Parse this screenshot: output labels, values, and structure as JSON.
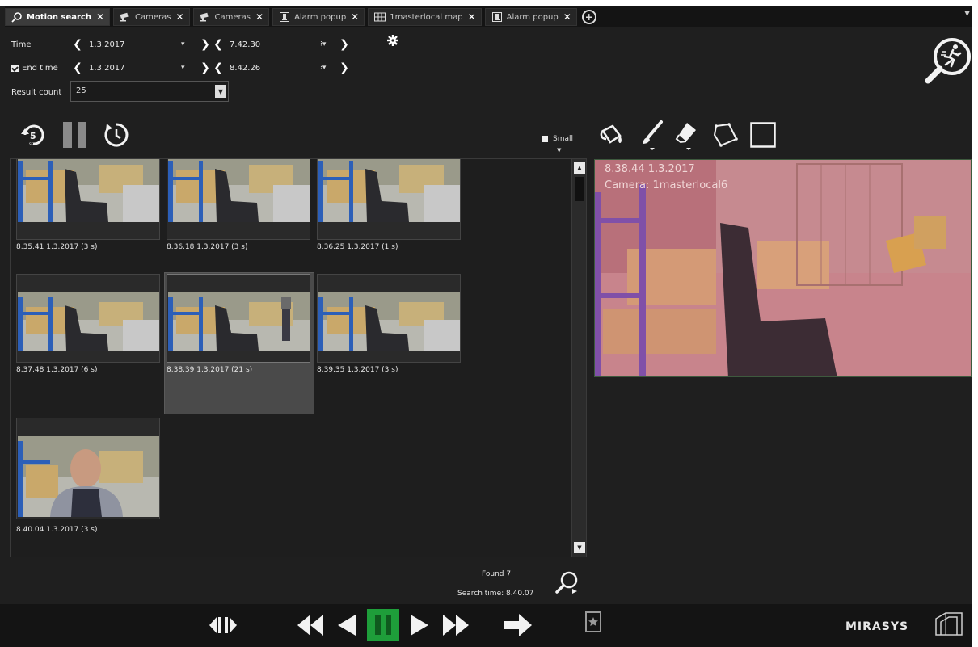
{
  "tabs": [
    {
      "label": "Motion search",
      "icon": "motion-search-icon",
      "active": true
    },
    {
      "label": "Cameras",
      "icon": "camera-icon",
      "active": false
    },
    {
      "label": "Cameras",
      "icon": "camera-icon",
      "active": false
    },
    {
      "label": "Alarm popup",
      "icon": "alarm-icon",
      "active": false
    },
    {
      "label": "1masterlocal map",
      "icon": "map-icon",
      "active": false
    },
    {
      "label": "Alarm popup",
      "icon": "alarm-icon",
      "active": false
    }
  ],
  "search": {
    "time_label": "Time",
    "end_time_label": "End time",
    "start_date": "1.3.2017",
    "start_time": "7.42.30",
    "end_date": "1.3.2017",
    "end_time": "8.42.26",
    "result_count_label": "Result count",
    "result_count": "25",
    "end_time_checked": true
  },
  "toolbar": {
    "small_label": "Small"
  },
  "results": [
    {
      "caption": "8.35.41  1.3.2017 (3 s)"
    },
    {
      "caption": "8.36.18  1.3.2017 (3 s)"
    },
    {
      "caption": "8.36.25  1.3.2017 (1 s)"
    },
    {
      "caption": "8.37.48  1.3.2017 (6 s)"
    },
    {
      "caption": "8.38.39  1.3.2017 (21 s)"
    },
    {
      "caption": "8.39.35  1.3.2017 (3 s)"
    },
    {
      "caption": "8.40.04  1.3.2017 (3 s)"
    }
  ],
  "preview": {
    "timestamp": "8.38.44  1.3.2017",
    "camera": "Camera: 1masterlocal6"
  },
  "status": {
    "found": "Found 7",
    "search_time": "Search time: 8.40.07"
  },
  "brand": "MIRASYS",
  "colors": {
    "accent": "#1e9e3a",
    "background": "#1f1f1f",
    "overlay": "#c8505a"
  }
}
